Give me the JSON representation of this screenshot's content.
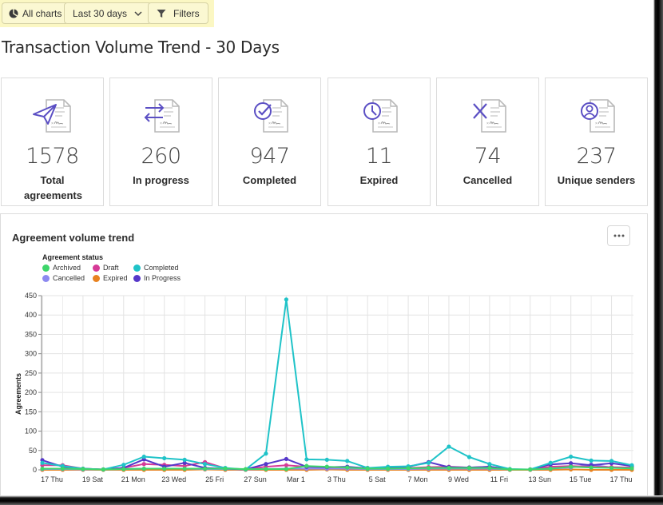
{
  "toolbar": {
    "all_charts_label": "All charts",
    "all_charts_icon": "pie-chart-icon",
    "date_range_label": "Last 30 days",
    "date_range_icon": "chevron-down-icon",
    "filters_label": "Filters",
    "filters_icon": "filter-icon",
    "highlight_color": "#fbf7c3"
  },
  "page_title": "Transaction Volume Trend - 30 Days",
  "accent_color": "#5b4fc4",
  "cards": [
    {
      "value": "1578",
      "label": "Total agreements",
      "icon": "send-document-icon"
    },
    {
      "value": "260",
      "label": "In progress",
      "icon": "transfer-document-icon"
    },
    {
      "value": "947",
      "label": "Completed",
      "icon": "check-document-icon"
    },
    {
      "value": "11",
      "label": "Expired",
      "icon": "clock-document-icon"
    },
    {
      "value": "74",
      "label": "Cancelled",
      "icon": "cancel-document-icon"
    },
    {
      "value": "237",
      "label": "Unique senders",
      "icon": "user-document-icon"
    }
  ],
  "chart_card": {
    "title": "Agreement volume trend",
    "more_button": "more-options-icon"
  },
  "chart_data": {
    "type": "line",
    "title": "Agreement volume trend",
    "xlabel": "",
    "ylabel": "Agreements",
    "ylim": [
      0,
      450
    ],
    "yticks": [
      0,
      50,
      100,
      150,
      200,
      250,
      300,
      350,
      400,
      450
    ],
    "grid": true,
    "legend_title": "Agreement status",
    "legend_position": "top-left",
    "x": [
      "Feb 17",
      "Feb 18",
      "Feb 19",
      "Feb 20",
      "Feb 21",
      "Feb 22",
      "Feb 23",
      "Feb 24",
      "Feb 25",
      "Feb 26",
      "Feb 27",
      "Feb 28",
      "Mar 1",
      "Mar 2",
      "Mar 3",
      "Mar 4",
      "Mar 5",
      "Mar 6",
      "Mar 7",
      "Mar 8",
      "Mar 9",
      "Mar 10",
      "Mar 11",
      "Mar 12",
      "Mar 13",
      "Mar 14",
      "Mar 15",
      "Mar 16",
      "Mar 17",
      "Mar 18"
    ],
    "xtick_labels": [
      {
        "index": 0,
        "label": "17 Thu"
      },
      {
        "index": 2,
        "label": "19 Sat"
      },
      {
        "index": 4,
        "label": "21 Mon"
      },
      {
        "index": 6,
        "label": "23 Wed"
      },
      {
        "index": 8,
        "label": "25 Fri"
      },
      {
        "index": 10,
        "label": "27 Sun"
      },
      {
        "index": 12,
        "label": "Mar 1"
      },
      {
        "index": 14,
        "label": "3 Thu"
      },
      {
        "index": 16,
        "label": "5 Sat"
      },
      {
        "index": 18,
        "label": "7 Mon"
      },
      {
        "index": 20,
        "label": "9 Wed"
      },
      {
        "index": 22,
        "label": "11 Fri"
      },
      {
        "index": 24,
        "label": "13 Sun"
      },
      {
        "index": 26,
        "label": "15 Tue"
      },
      {
        "index": 28,
        "label": "17 Thu"
      }
    ],
    "series": [
      {
        "name": "Archived",
        "color": "#3ed66b",
        "values": [
          3,
          3,
          2,
          1,
          2,
          3,
          3,
          3,
          3,
          3,
          2,
          2,
          2,
          10,
          8,
          6,
          3,
          3,
          4,
          5,
          5,
          5,
          5,
          1,
          1,
          3,
          8,
          6,
          5,
          4
        ]
      },
      {
        "name": "Draft",
        "color": "#d63a97",
        "values": [
          12,
          12,
          3,
          1,
          5,
          15,
          13,
          10,
          20,
          4,
          1,
          8,
          12,
          8,
          7,
          6,
          5,
          5,
          5,
          7,
          8,
          6,
          8,
          1,
          1,
          8,
          10,
          8,
          7,
          6
        ]
      },
      {
        "name": "Completed",
        "color": "#1fc3c8",
        "values": [
          18,
          10,
          3,
          1,
          13,
          34,
          30,
          26,
          15,
          5,
          1,
          42,
          440,
          27,
          26,
          23,
          5,
          8,
          9,
          18,
          60,
          33,
          15,
          2,
          1,
          18,
          34,
          24,
          23,
          12
        ]
      },
      {
        "name": "Cancelled",
        "color": "#8c89f0",
        "values": [
          2,
          2,
          1,
          1,
          2,
          3,
          3,
          3,
          2,
          2,
          1,
          2,
          3,
          3,
          3,
          3,
          2,
          2,
          2,
          3,
          3,
          3,
          3,
          1,
          1,
          3,
          6,
          14,
          6,
          4
        ]
      },
      {
        "name": "Expired",
        "color": "#e8821f",
        "values": [
          0,
          0,
          0,
          0,
          0,
          0,
          0,
          0,
          1,
          0,
          0,
          0,
          0,
          0,
          1,
          0,
          0,
          0,
          0,
          0,
          0,
          0,
          0,
          0,
          0,
          0,
          1,
          0,
          0,
          0
        ]
      },
      {
        "name": "In Progress",
        "color": "#5537c9",
        "values": [
          25,
          8,
          3,
          1,
          5,
          27,
          8,
          18,
          5,
          3,
          1,
          15,
          28,
          8,
          7,
          8,
          4,
          5,
          8,
          20,
          7,
          6,
          8,
          1,
          1,
          14,
          17,
          12,
          17,
          10
        ]
      }
    ]
  }
}
